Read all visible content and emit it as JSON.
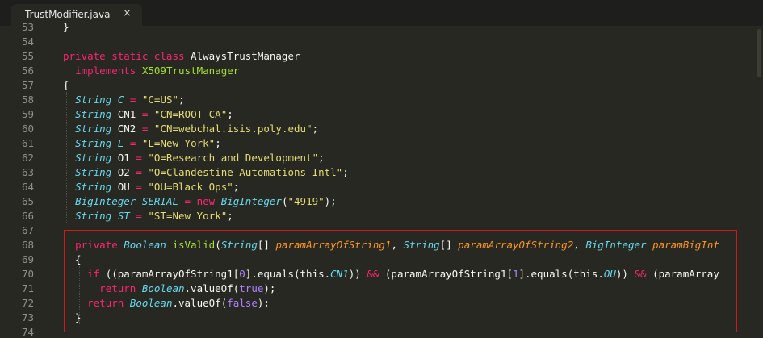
{
  "tab": {
    "title": "TrustModifier.java",
    "close_glyph": "×"
  },
  "editor": {
    "colors": {
      "background": "#272822",
      "highlight_box": "#d0191c",
      "keyword": "#f92672",
      "type": "#66d9ef",
      "string": "#e6db74",
      "class_name": "#a6e22e",
      "param": "#fd971f"
    },
    "lines": [
      {
        "n": "53",
        "tokens": [
          [
            "pl",
            "}"
          ]
        ]
      },
      {
        "n": "54",
        "tokens": []
      },
      {
        "n": "55",
        "tokens": [
          [
            "kw",
            "private static class "
          ],
          [
            "pl",
            "AlwaysTrustManager"
          ]
        ]
      },
      {
        "n": "56",
        "tokens": [
          [
            "pl",
            "  "
          ],
          [
            "kw",
            "implements "
          ],
          [
            "cls",
            "X509TrustManager"
          ]
        ]
      },
      {
        "n": "57",
        "tokens": [
          [
            "pl",
            "{"
          ]
        ]
      },
      {
        "n": "58",
        "tokens": [
          [
            "pl",
            "  "
          ],
          [
            "st",
            "String"
          ],
          [
            "pl",
            " "
          ],
          [
            "st",
            "C"
          ],
          [
            "pl",
            " "
          ],
          [
            "kw",
            "="
          ],
          [
            "pl",
            " "
          ],
          [
            "str",
            "\"C=US\""
          ],
          [
            "pl",
            ";"
          ]
        ]
      },
      {
        "n": "59",
        "tokens": [
          [
            "pl",
            "  "
          ],
          [
            "st",
            "String"
          ],
          [
            "pl",
            " CN1 "
          ],
          [
            "kw",
            "="
          ],
          [
            "pl",
            " "
          ],
          [
            "str",
            "\"CN=ROOT CA\""
          ],
          [
            "pl",
            ";"
          ]
        ]
      },
      {
        "n": "60",
        "tokens": [
          [
            "pl",
            "  "
          ],
          [
            "st",
            "String"
          ],
          [
            "pl",
            " CN2 "
          ],
          [
            "kw",
            "="
          ],
          [
            "pl",
            " "
          ],
          [
            "str",
            "\"CN=webchal.isis.poly.edu\""
          ],
          [
            "pl",
            ";"
          ]
        ]
      },
      {
        "n": "61",
        "tokens": [
          [
            "pl",
            "  "
          ],
          [
            "st",
            "String"
          ],
          [
            "pl",
            " "
          ],
          [
            "st",
            "L"
          ],
          [
            "pl",
            " "
          ],
          [
            "kw",
            "="
          ],
          [
            "pl",
            " "
          ],
          [
            "str",
            "\"L=New York\""
          ],
          [
            "pl",
            ";"
          ]
        ]
      },
      {
        "n": "62",
        "tokens": [
          [
            "pl",
            "  "
          ],
          [
            "st",
            "String"
          ],
          [
            "pl",
            " O1 "
          ],
          [
            "kw",
            "="
          ],
          [
            "pl",
            " "
          ],
          [
            "str",
            "\"O=Research and Development\""
          ],
          [
            "pl",
            ";"
          ]
        ]
      },
      {
        "n": "63",
        "tokens": [
          [
            "pl",
            "  "
          ],
          [
            "st",
            "String"
          ],
          [
            "pl",
            " O2 "
          ],
          [
            "kw",
            "="
          ],
          [
            "pl",
            " "
          ],
          [
            "str",
            "\"O=Clandestine Automations Intl\""
          ],
          [
            "pl",
            ";"
          ]
        ]
      },
      {
        "n": "64",
        "tokens": [
          [
            "pl",
            "  "
          ],
          [
            "st",
            "String"
          ],
          [
            "pl",
            " OU "
          ],
          [
            "kw",
            "="
          ],
          [
            "pl",
            " "
          ],
          [
            "str",
            "\"OU=Black Ops\""
          ],
          [
            "pl",
            ";"
          ]
        ]
      },
      {
        "n": "65",
        "tokens": [
          [
            "pl",
            "  "
          ],
          [
            "st",
            "BigInteger"
          ],
          [
            "pl",
            " "
          ],
          [
            "st",
            "SERIAL"
          ],
          [
            "pl",
            " "
          ],
          [
            "kw",
            "= new "
          ],
          [
            "st",
            "BigInteger"
          ],
          [
            "pl",
            "("
          ],
          [
            "str",
            "\"4919\""
          ],
          [
            "pl",
            ");"
          ]
        ]
      },
      {
        "n": "66",
        "tokens": [
          [
            "pl",
            "  "
          ],
          [
            "st",
            "String"
          ],
          [
            "pl",
            " "
          ],
          [
            "st",
            "ST"
          ],
          [
            "pl",
            " "
          ],
          [
            "kw",
            "="
          ],
          [
            "pl",
            " "
          ],
          [
            "str",
            "\"ST=New York\""
          ],
          [
            "pl",
            ";"
          ]
        ]
      },
      {
        "n": "67",
        "tokens": []
      },
      {
        "n": "68",
        "tokens": [
          [
            "pl",
            "  "
          ],
          [
            "kw",
            "private "
          ],
          [
            "st",
            "Boolean"
          ],
          [
            "pl",
            " "
          ],
          [
            "fn",
            "isValid"
          ],
          [
            "pl",
            "("
          ],
          [
            "st",
            "String"
          ],
          [
            "pl",
            "[] "
          ],
          [
            "par",
            "paramArrayOfString1"
          ],
          [
            "pl",
            ", "
          ],
          [
            "st",
            "String"
          ],
          [
            "pl",
            "[] "
          ],
          [
            "par",
            "paramArrayOfString2"
          ],
          [
            "pl",
            ", "
          ],
          [
            "st",
            "BigInteger"
          ],
          [
            "pl",
            " "
          ],
          [
            "par",
            "paramBigInt"
          ]
        ]
      },
      {
        "n": "69",
        "tokens": [
          [
            "pl",
            "  {"
          ]
        ]
      },
      {
        "n": "70",
        "tokens": [
          [
            "pl",
            "    "
          ],
          [
            "kw",
            "if"
          ],
          [
            "pl",
            " ((paramArrayOfString1["
          ],
          [
            "cn",
            "0"
          ],
          [
            "pl",
            "].equals(this."
          ],
          [
            "st",
            "CN1"
          ],
          [
            "pl",
            ")) "
          ],
          [
            "kw",
            "&&"
          ],
          [
            "pl",
            " (paramArrayOfString1["
          ],
          [
            "cn",
            "1"
          ],
          [
            "pl",
            "].equals(this."
          ],
          [
            "st",
            "OU"
          ],
          [
            "pl",
            ")) "
          ],
          [
            "kw",
            "&&"
          ],
          [
            "pl",
            " (paramArray"
          ]
        ]
      },
      {
        "n": "71",
        "tokens": [
          [
            "pl",
            "      "
          ],
          [
            "kw",
            "return "
          ],
          [
            "st",
            "Boolean"
          ],
          [
            "pl",
            ".valueOf("
          ],
          [
            "cn",
            "true"
          ],
          [
            "pl",
            ");"
          ]
        ]
      },
      {
        "n": "72",
        "tokens": [
          [
            "pl",
            "    "
          ],
          [
            "kw",
            "return "
          ],
          [
            "st",
            "Boolean"
          ],
          [
            "pl",
            ".valueOf("
          ],
          [
            "cn",
            "false"
          ],
          [
            "pl",
            ");"
          ]
        ]
      },
      {
        "n": "73",
        "tokens": [
          [
            "pl",
            "  }"
          ]
        ]
      },
      {
        "n": "74",
        "tokens": []
      }
    ]
  }
}
